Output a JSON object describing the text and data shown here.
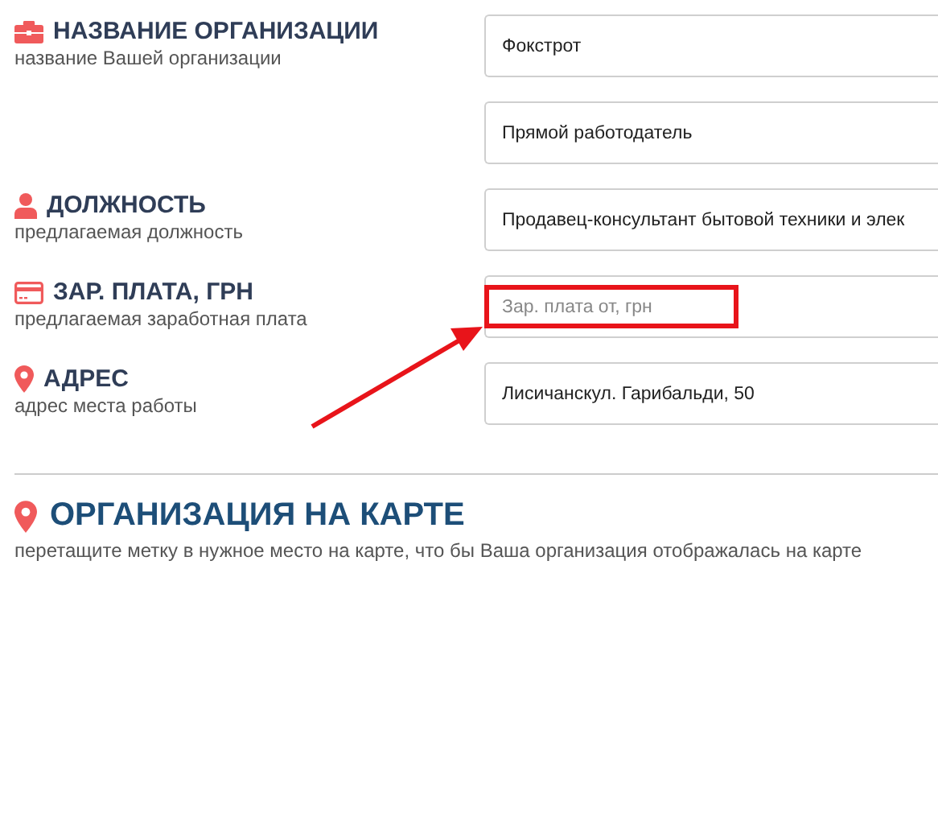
{
  "fields": [
    {
      "label": {
        "title": "НАЗВАНИЕ ОРГАНИЗАЦИИ",
        "hint": "название Вашей организации"
      },
      "value": "Фокстрот",
      "highlighted": false
    },
    {
      "value": "Прямой работодатель",
      "highlighted": false
    },
    {
      "label": {
        "title": "ДОЛЖНОСТЬ",
        "hint": "предлагаемая должность"
      },
      "value": "Продавец-консультант бытовой техники и элек",
      "highlighted": false
    },
    {
      "label": {
        "title": "ЗАР. ПЛАТА, ГРН",
        "hint": "предлагаемая заработная плата"
      },
      "placeholder": "Зар. плата от, грн",
      "highlighted": true
    },
    {
      "label": {
        "title": "АДРЕС",
        "hint": "адрес места работы"
      },
      "value": "Лисичанскул. Гарибальди, 50",
      "highlighted": false
    }
  ],
  "map_section": {
    "title": "ОРГАНИЗАЦИЯ НА КАРТЕ",
    "hint": "перетащите метку в нужное место на карте, что бы Ваша организация отображалась на карте"
  }
}
